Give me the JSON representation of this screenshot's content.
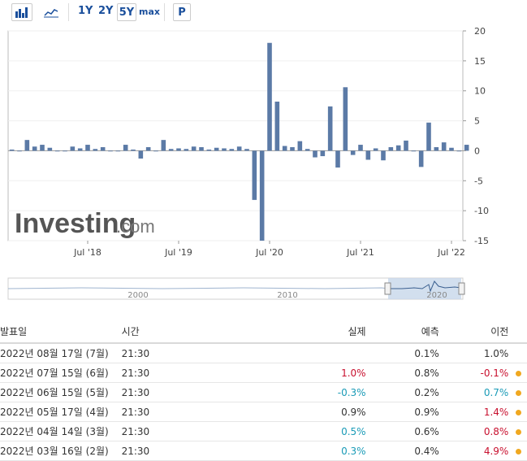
{
  "toolbar": {
    "bar_icon": "bar-chart-icon",
    "line_icon": "line-chart-icon",
    "ranges": [
      "1Y",
      "2Y",
      "5Y",
      "max"
    ],
    "active_range": "5Y",
    "p_button": "P"
  },
  "watermark": "Investing",
  "watermark_suffix": ".com",
  "colors": {
    "bar": "#5b7aa6",
    "navigator_fill": "#c7d7ea",
    "negative": "#1a9bb7",
    "positive": "#c8102e",
    "dot": "#f0a820"
  },
  "chart_data": {
    "type": "bar",
    "ylim": [
      -15,
      20
    ],
    "yticks": [
      20,
      15,
      10,
      5,
      0,
      -5,
      -10,
      -15
    ],
    "xticks": [
      "Jul '18",
      "Jul '19",
      "Jul '20",
      "Jul '21",
      "Jul '22"
    ],
    "x_start": "2017-09",
    "x_end": "2022-08",
    "series": [
      {
        "values": [
          0.2,
          0.0,
          1.8,
          0.7,
          1.0,
          0.5,
          0.0,
          0.0,
          0.7,
          0.4,
          1.0,
          0.3,
          0.6,
          0.0,
          0.0,
          1.0,
          0.2,
          -1.3,
          0.6,
          0.0,
          1.8,
          0.3,
          0.4,
          0.3,
          0.7,
          0.6,
          0.2,
          0.5,
          0.4,
          0.3,
          0.7,
          0.3,
          -8.2,
          -15.0,
          18.0,
          8.2,
          0.8,
          0.6,
          1.6,
          0.3,
          -1.1,
          -0.9,
          7.4,
          -2.8,
          10.6,
          -0.7,
          1.0,
          -1.5,
          0.4,
          -1.6,
          0.6,
          0.9,
          1.7,
          0.0,
          -2.7,
          4.7,
          0.6,
          1.4,
          0.5,
          0.0,
          1.0
        ]
      }
    ]
  },
  "navigator": {
    "labels": [
      "2000",
      "2010",
      "2020"
    ]
  },
  "table": {
    "headers": {
      "date": "발표일",
      "time": "시간",
      "actual": "실제",
      "forecast": "예측",
      "previous": "이전"
    },
    "rows": [
      {
        "date": "2022년 08월 17일 (7월)",
        "time": "21:30",
        "actual": "",
        "actual_class": "",
        "forecast": "0.1%",
        "previous": "1.0%",
        "previous_class": "",
        "dot": false
      },
      {
        "date": "2022년 07월 15일 (6월)",
        "time": "21:30",
        "actual": "1.0%",
        "actual_class": "pos",
        "forecast": "0.8%",
        "previous": "-0.1%",
        "previous_class": "pos",
        "dot": true
      },
      {
        "date": "2022년 06월 15일 (5월)",
        "time": "21:30",
        "actual": "-0.3%",
        "actual_class": "neg",
        "forecast": "0.2%",
        "previous": "0.7%",
        "previous_class": "neg",
        "dot": true
      },
      {
        "date": "2022년 05월 17일 (4월)",
        "time": "21:30",
        "actual": "0.9%",
        "actual_class": "",
        "forecast": "0.9%",
        "previous": "1.4%",
        "previous_class": "pos",
        "dot": true
      },
      {
        "date": "2022년 04월 14일 (3월)",
        "time": "21:30",
        "actual": "0.5%",
        "actual_class": "neg",
        "forecast": "0.6%",
        "previous": "0.8%",
        "previous_class": "pos",
        "dot": true
      },
      {
        "date": "2022년 03월 16일 (2월)",
        "time": "21:30",
        "actual": "0.3%",
        "actual_class": "neg",
        "forecast": "0.4%",
        "previous": "4.9%",
        "previous_class": "pos",
        "dot": true
      }
    ]
  }
}
